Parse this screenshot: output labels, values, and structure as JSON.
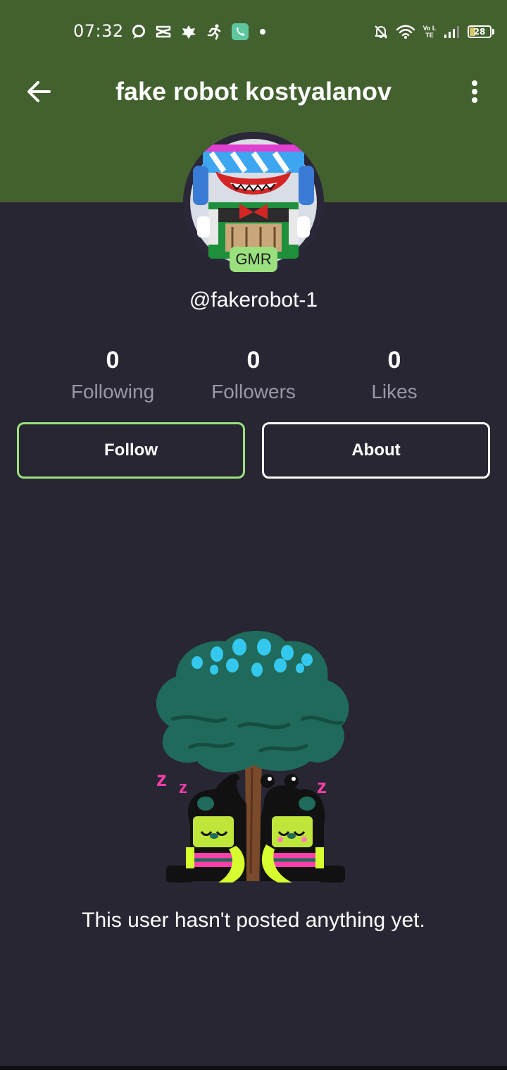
{
  "status_bar": {
    "time": "07:32",
    "battery_level": "28",
    "volte_label": "Vo LTE",
    "icons": [
      "chat-bubble-icon",
      "capcut-icon",
      "app-leaf-icon",
      "running-icon",
      "phone-call-icon",
      "dot-icon",
      "mute-bell-icon",
      "wifi-icon",
      "volte-icon",
      "signal-icon",
      "battery-icon"
    ]
  },
  "header": {
    "title": "fake robot kostyalanov",
    "back_icon": "arrow-left-icon",
    "menu_icon": "more-vertical-icon",
    "background": "#43602f"
  },
  "profile": {
    "badge": "GMR",
    "handle": "@fakerobot-1"
  },
  "stats": [
    {
      "value": "0",
      "label": "Following"
    },
    {
      "value": "0",
      "label": "Followers"
    },
    {
      "value": "0",
      "label": "Likes"
    }
  ],
  "actions": {
    "follow_label": "Follow",
    "about_label": "About",
    "follow_border_color": "#9be07e"
  },
  "empty_state": {
    "text": "This user hasn't posted anything yet.",
    "illustration": "sleeping-creatures-under-tree"
  },
  "colors": {
    "background": "#282633",
    "accent_green": "#9be07e",
    "muted_text": "#9a98a6"
  }
}
